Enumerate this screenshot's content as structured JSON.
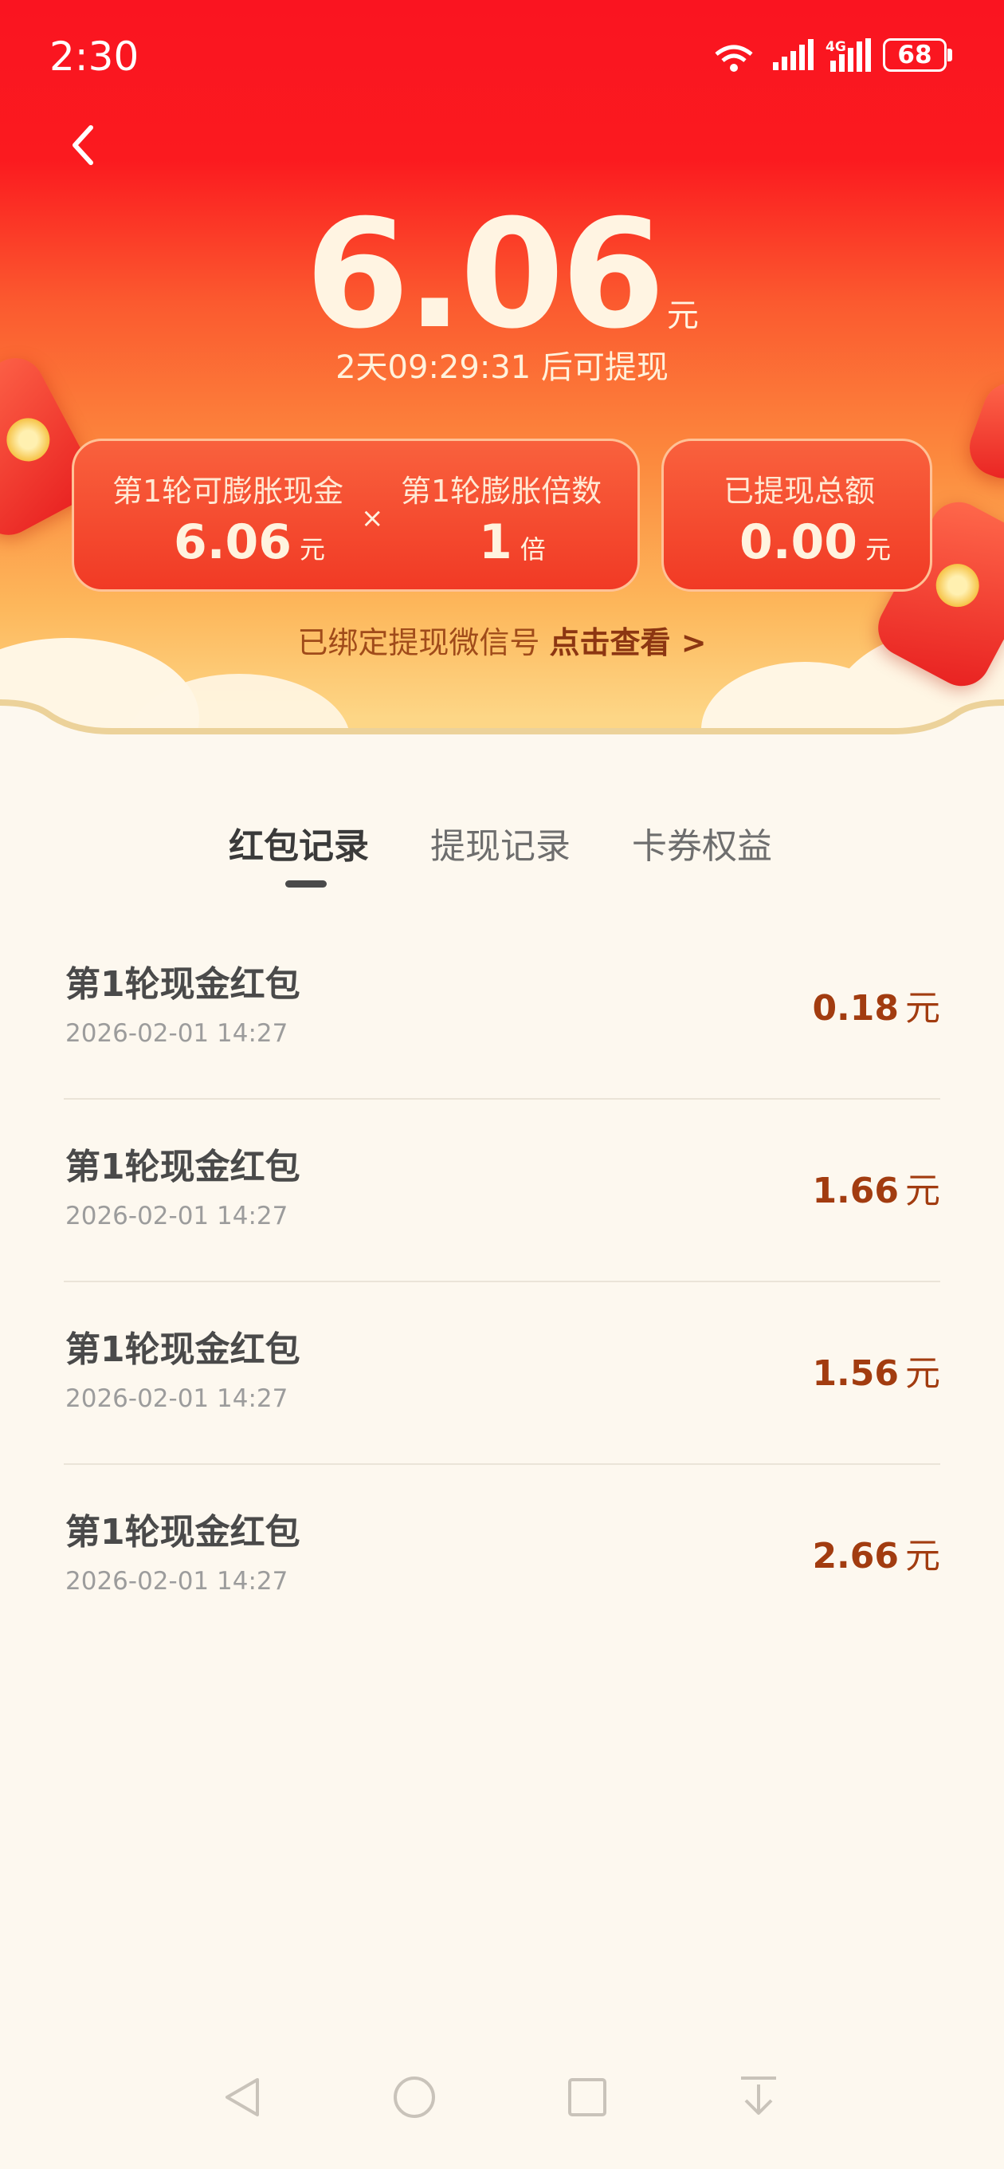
{
  "status": {
    "time": "2:30",
    "battery": "68"
  },
  "header": {
    "amount": "6.06",
    "amount_unit": "元",
    "countdown": "2天09:29:31 后可提现"
  },
  "cards": {
    "inflatable_label": "第1轮可膨胀现金",
    "inflatable_value": "6.06",
    "inflatable_unit": "元",
    "times_symbol": "×",
    "multiplier_label": "第1轮膨胀倍数",
    "multiplier_value": "1",
    "multiplier_unit": "倍",
    "withdrawn_label": "已提现总额",
    "withdrawn_value": "0.00",
    "withdrawn_unit": "元"
  },
  "bind": {
    "text": "已绑定提现微信号 ",
    "link": "点击查看 >"
  },
  "tabs": [
    {
      "label": "红包记录"
    },
    {
      "label": "提现记录"
    },
    {
      "label": "卡券权益"
    }
  ],
  "records": [
    {
      "title": "第1轮现金红包",
      "date": "2026-02-01 14:27",
      "amount": "0.18",
      "unit": "元"
    },
    {
      "title": "第1轮现金红包",
      "date": "2026-02-01 14:27",
      "amount": "1.66",
      "unit": "元"
    },
    {
      "title": "第1轮现金红包",
      "date": "2026-02-01 14:27",
      "amount": "1.56",
      "unit": "元"
    },
    {
      "title": "第1轮现金红包",
      "date": "2026-02-01 14:27",
      "amount": "2.66",
      "unit": "元"
    }
  ],
  "colors": {
    "header_red": "#fa1420",
    "amount_brown": "#a23c10",
    "background": "#fdf8ef"
  },
  "icons": [
    "back-icon",
    "wifi-icon",
    "signal-icon",
    "signal-4g-icon",
    "battery-icon",
    "nav-back-icon",
    "nav-home-icon",
    "nav-recents-icon",
    "nav-collapse-icon"
  ]
}
